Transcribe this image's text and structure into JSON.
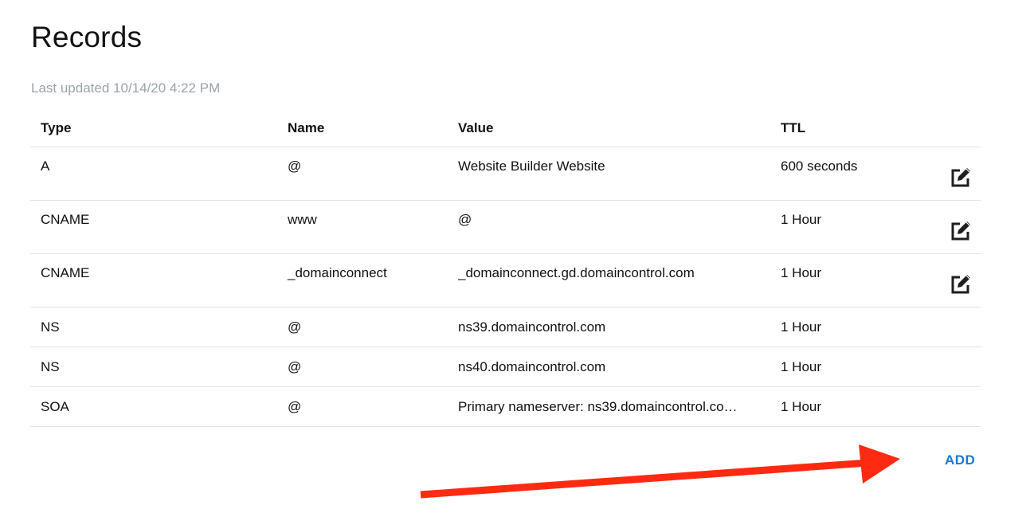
{
  "page": {
    "title": "Records",
    "last_updated": "Last updated 10/14/20 4:22 PM"
  },
  "table": {
    "headers": {
      "type": "Type",
      "name": "Name",
      "value": "Value",
      "ttl": "TTL"
    },
    "rows": [
      {
        "type": "A",
        "name": "@",
        "value": "Website Builder Website",
        "ttl": "600 seconds",
        "editable": true
      },
      {
        "type": "CNAME",
        "name": "www",
        "value": "@",
        "ttl": "1 Hour",
        "editable": true
      },
      {
        "type": "CNAME",
        "name": "_domainconnect",
        "value": "_domainconnect.gd.domaincontrol.com",
        "ttl": "1 Hour",
        "editable": true
      },
      {
        "type": "NS",
        "name": "@",
        "value": "ns39.domaincontrol.com",
        "ttl": "1 Hour",
        "editable": false
      },
      {
        "type": "NS",
        "name": "@",
        "value": "ns40.domaincontrol.com",
        "ttl": "1 Hour",
        "editable": false
      },
      {
        "type": "SOA",
        "name": "@",
        "value": "Primary nameserver: ns39.domaincontrol.co…",
        "ttl": "1 Hour",
        "editable": false
      }
    ],
    "edit_icon": "edit-icon"
  },
  "actions": {
    "add_label": "ADD"
  },
  "annotation": {
    "arrow_color": "#ff2a12",
    "icon": "arrow-right-icon"
  },
  "colors": {
    "accent": "#1976d2",
    "muted_text": "#9aa3ab",
    "divider": "#e3e3e3"
  }
}
